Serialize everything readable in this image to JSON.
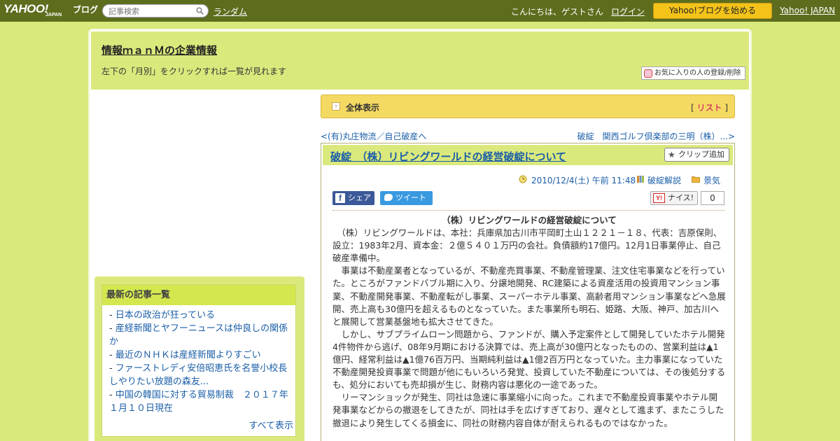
{
  "topbar": {
    "logo_yahoo": "YAHOO!",
    "logo_japan": "JAPAN",
    "logo_blog": "ブログ",
    "search_placeholder": "記事検索",
    "random": "ランダム",
    "greeting": "こんにちは、ゲストさん",
    "login": "ログイン",
    "start_blog": "Yahoo!ブログを始める",
    "yahoo_japan": "Yahoo! JAPAN"
  },
  "header": {
    "title": "情報ｍａｎＭの企業情報",
    "description": "左下の「月別」をクリックすれば一覧が見れます",
    "favorite_button": "お気に入りの人の登録/削除"
  },
  "sidebar": {
    "recent_heading": "最新の記事一覧",
    "recent_items": [
      "日本の政治が狂っている",
      "産経新聞とヤフーニュースは仲良しの関係か",
      "最近のＮＨＫは産経新聞よりすごい",
      "ファーストレディ安倍昭恵氏を名誉小校長しやりたい放題の森友...",
      "中国の韓国に対する貿易制裁　２０１７年１月１０日現在"
    ],
    "show_all": "すべて表示"
  },
  "main": {
    "all_view_label": "全体表示",
    "list_bracket_open": "[",
    "list_link": "リスト",
    "list_bracket_close": "]",
    "prev_link": "<(有)丸庄物流／自己破産へ",
    "next_link": "破綻　関西ゴルフ倶楽部の三明（株）...>",
    "article": {
      "title": "破綻　（株）リビングワールドの経営破綻について",
      "clip_button": "クリップ追加",
      "date": "2010/12/4(土) 午前 11:48",
      "category": "破綻解説",
      "folder": "景気",
      "share_facebook": "シェア",
      "share_twitter": "ツイート",
      "nice_label": "ナイス!",
      "nice_count": "0",
      "body_title": "（株）リビングワールドの経営破綻について",
      "paragraphs": [
        "　（株）リビングワールドは、本社：兵庫県加古川市平岡町土山１２２１－１８、代表：吉原保則、設立：1983年2月、資本金：２億５４０１万円の会社。負債額約17億円。12月1日事業停止、自己破産準備中。",
        "　事業は不動産業者となっているが、不動産売買事業、不動産管理業、注文住宅事業などを行っていた。ところがファンドバブル期に入り、分譲地開発、RC建築による資産活用の投資用マンション事業、不動産開発事業、不動産転がし事業、スーパーホテル事業、高齢者用マンション事業などへ急展開、売上高も30億円を超えるものとなっていた。また事業所も明石、姫路、大阪、神戸、加古川へと展開して営業基盤地も拡大させてきた。",
        "　しかし、サブプライムローン問題から、ファンドが、購入予定案件として開発していたホテル開発4件物件から逃げ、08年9月期における決算では、売上高が30億円となったものの、営業利益は▲1億円、経常利益は▲1億76百万円、当期純利益は▲1億2百万円となっていた。主力事業になっていた不動産開発投資事業で問題が他にもいろいろ発覚、投資していた不動産については、その後処分するも、処分においても売却損が生じ、財務内容は悪化の一途であった。",
        "　リーマンショックが発生、同社は急速に事業縮小に向った。これまで不動産投資事業やホテル開発事業などからの撤退をしてきたが、同社は手を広げすぎており、遅々として進まず、またこうした撤退により発生してくる損金に、同社の財務内容自体が耐えられるものではなかった。"
      ]
    }
  },
  "colors": {
    "topbar": "#5d6d1e",
    "background": "#d8e87a",
    "header": "#dbe97c",
    "allview": "#f4d963",
    "start_button": "#f3c31a",
    "link": "#1a5ea8"
  }
}
